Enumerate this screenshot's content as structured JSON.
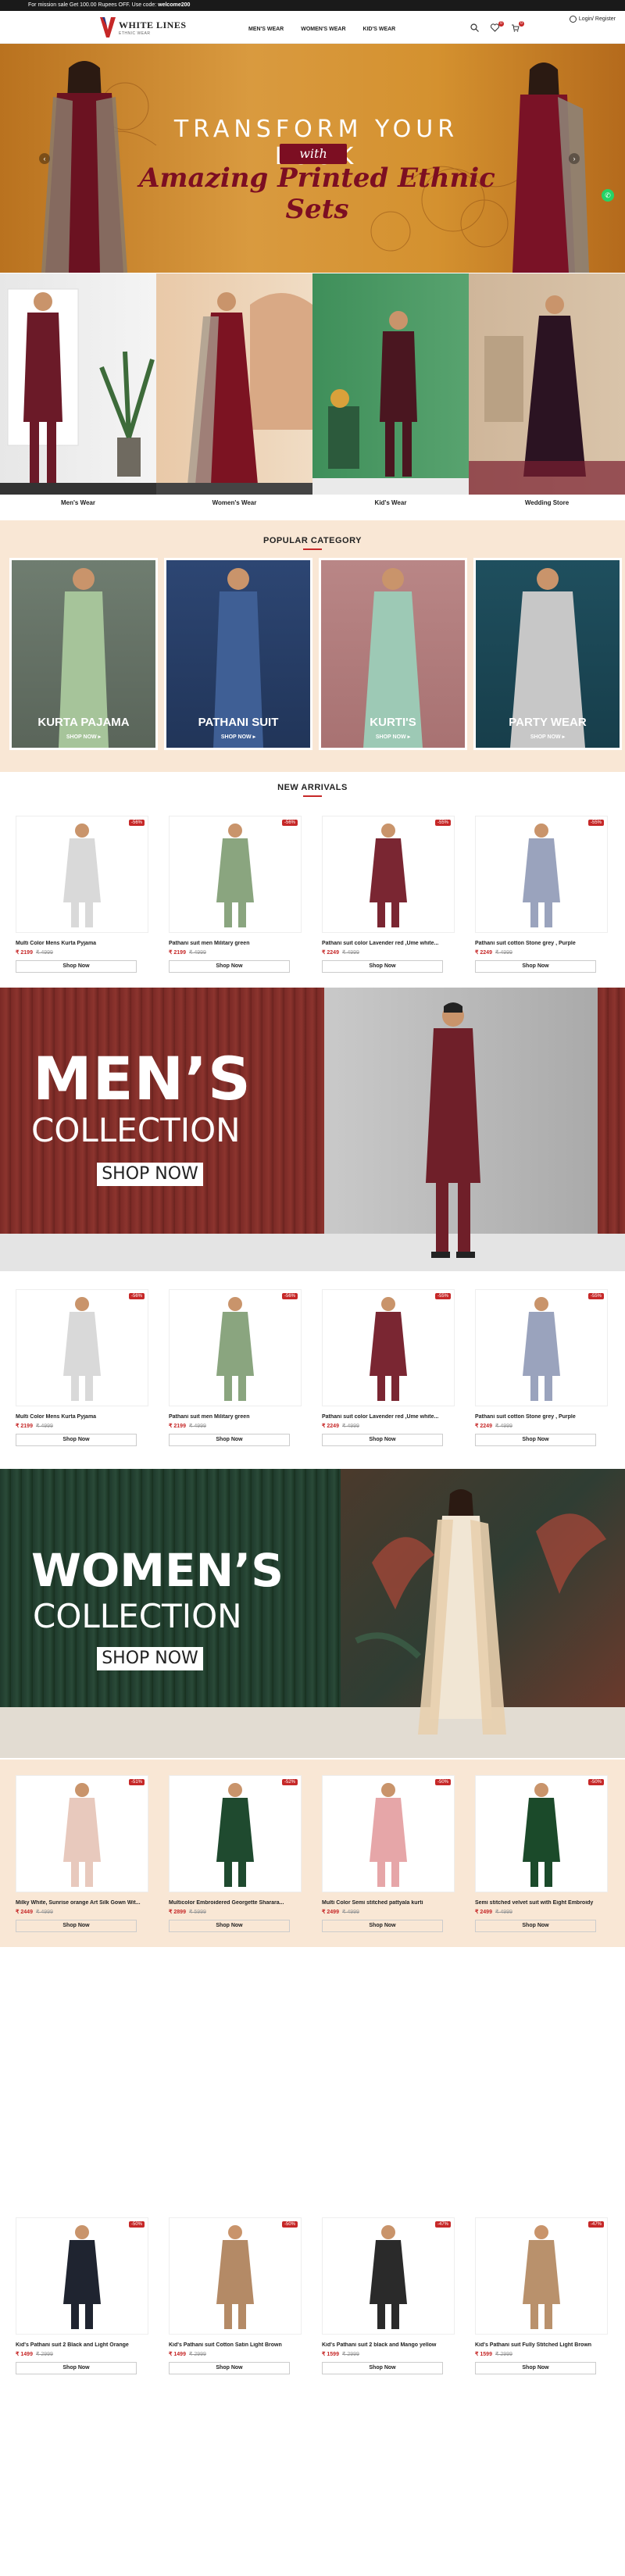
{
  "topbar": {
    "text": "For mission sale Get 100.00 Rupees OFF. Use code:",
    "code": "welcome200"
  },
  "header": {
    "logo_title": "WHITE LINES",
    "logo_sub": "ETHNIC WEAR",
    "nav": [
      "MEN'S WEAR",
      "WOMEN'S WEAR",
      "KID'S WEAR"
    ],
    "login_label": "Login/ Register",
    "wishlist_count": "0",
    "cart_count": "0"
  },
  "hero": {
    "line1": "TRANSFORM YOUR LOOK",
    "with": "with",
    "line2": "Amazing Printed Ethnic Sets"
  },
  "category_tiles": [
    {
      "label": "Men's Wear"
    },
    {
      "label": "Women's Wear"
    },
    {
      "label": "Kid's Wear"
    },
    {
      "label": "Wedding Store"
    }
  ],
  "popular": {
    "title": "POPULAR CATEGORY",
    "items": [
      {
        "label": "KURTA PAJAMA",
        "shop": "SHOP NOW ▸"
      },
      {
        "label": "PATHANI SUIT",
        "shop": "SHOP NOW ▸"
      },
      {
        "label": "KURTI'S",
        "shop": "SHOP NOW ▸"
      },
      {
        "label": "PARTY WEAR",
        "shop": "SHOP NOW ▸"
      }
    ]
  },
  "new_arrivals": {
    "title": "NEW ARRIVALS",
    "products": [
      {
        "name": "Multi Color Mens Kurta Pyjama",
        "price": "₹ 2199",
        "old": "₹ 4999",
        "discount": "-56%",
        "btn": "Shop Now",
        "color": "#d9d9d9"
      },
      {
        "name": "Pathani suit men Military green",
        "price": "₹ 2199",
        "old": "₹ 4999",
        "discount": "-56%",
        "btn": "Shop Now",
        "color": "#8aa57f"
      },
      {
        "name": "Pathani suit color Lavender red ,Ume white...",
        "price": "₹ 2249",
        "old": "₹ 4999",
        "discount": "-55%",
        "btn": "Shop Now",
        "color": "#7a2632"
      },
      {
        "name": "Pathani suit cotton Stone grey , Purple",
        "price": "₹ 2249",
        "old": "₹ 4999",
        "discount": "-55%",
        "btn": "Shop Now",
        "color": "#9aa3bd"
      }
    ]
  },
  "mens_banner": {
    "line1": "MEN’S",
    "line2": "COLLECTION",
    "btn": "SHOP NOW"
  },
  "mens_products": [
    {
      "name": "Multi Color Mens Kurta Pyjama",
      "price": "₹ 2199",
      "old": "₹ 4999",
      "discount": "-56%",
      "btn": "Shop Now",
      "color": "#d9d9d9"
    },
    {
      "name": "Pathani suit men Military green",
      "price": "₹ 2199",
      "old": "₹ 4999",
      "discount": "-56%",
      "btn": "Shop Now",
      "color": "#8aa57f"
    },
    {
      "name": "Pathani suit color Lavender red ,Ume white...",
      "price": "₹ 2249",
      "old": "₹ 4999",
      "discount": "-55%",
      "btn": "Shop Now",
      "color": "#7a2632"
    },
    {
      "name": "Pathani suit cotton Stone grey , Purple",
      "price": "₹ 2249",
      "old": "₹ 4999",
      "discount": "-55%",
      "btn": "Shop Now",
      "color": "#9aa3bd"
    }
  ],
  "womens_banner": {
    "line1": "WOMEN’S",
    "line2": "COLLECTION",
    "btn": "SHOP NOW"
  },
  "womens_products": [
    {
      "name": "Milky White, Sunrise orange Art Silk Gown Wit...",
      "price": "₹ 2449",
      "old": "₹ 4999",
      "discount": "-51%",
      "btn": "Shop Now",
      "color": "#e8c9bd"
    },
    {
      "name": "Multicolor Embroidered Georgette Sharara...",
      "price": "₹ 2899",
      "old": "₹ 5999",
      "discount": "-52%",
      "btn": "Shop Now",
      "color": "#1f4a2f"
    },
    {
      "name": "Multi Color Semi stitched pattyala kurti",
      "price": "₹ 2499",
      "old": "₹ 4999",
      "discount": "-50%",
      "btn": "Shop Now",
      "color": "#e6a6a8"
    },
    {
      "name": "Semi stitched velvet suit with Eight Embroidy",
      "price": "₹ 2499",
      "old": "₹ 4999",
      "discount": "-50%",
      "btn": "Shop Now",
      "color": "#1b4a2a"
    }
  ],
  "kids_products": [
    {
      "name": "Kid's Pathani suit 2 Black and Light Orange",
      "price": "₹ 1499",
      "old": "₹ 2999",
      "discount": "-50%",
      "btn": "Shop Now",
      "color": "#1f2430"
    },
    {
      "name": "Kid's Pathani suit Cotton Satin Light Brown",
      "price": "₹ 1499",
      "old": "₹ 2999",
      "discount": "-50%",
      "btn": "Shop Now",
      "color": "#b48a66"
    },
    {
      "name": "Kid's Pathani suit 2 black and Mango yellow",
      "price": "₹ 1599",
      "old": "₹ 2999",
      "discount": "-47%",
      "btn": "Shop Now",
      "color": "#2a2a2a"
    },
    {
      "name": "Kid's Pathani suit Fully Stitched Light Brown",
      "price": "₹ 1599",
      "old": "₹ 2999",
      "discount": "-47%",
      "btn": "Shop Now",
      "color": "#b9916c"
    }
  ],
  "colors": {
    "accent": "#c62828",
    "maroon": "#7c0e22",
    "peach": "#f9e7d5"
  }
}
